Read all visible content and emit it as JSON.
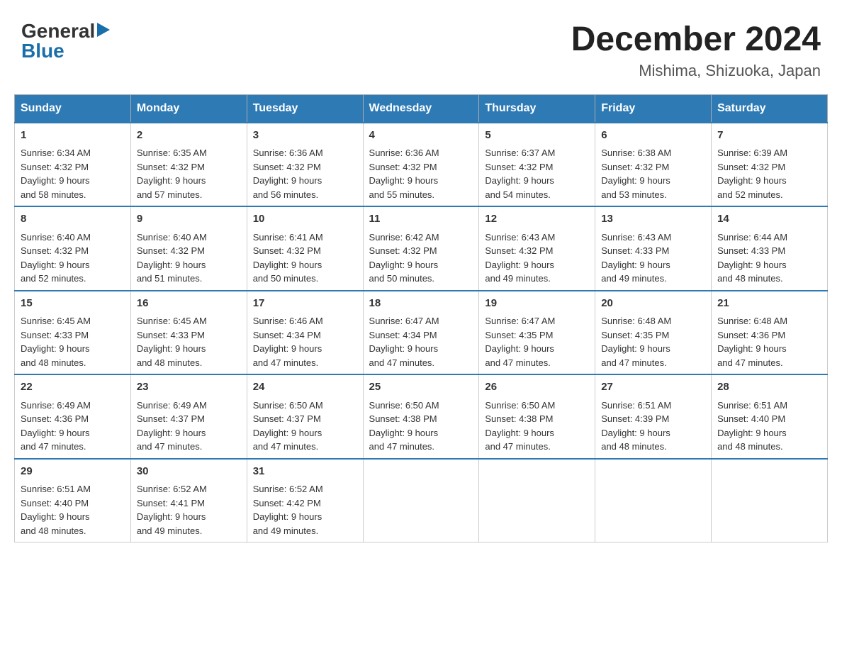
{
  "header": {
    "logo_general": "General",
    "logo_blue": "Blue",
    "title": "December 2024",
    "subtitle": "Mishima, Shizuoka, Japan"
  },
  "days_of_week": [
    "Sunday",
    "Monday",
    "Tuesday",
    "Wednesday",
    "Thursday",
    "Friday",
    "Saturday"
  ],
  "weeks": [
    [
      {
        "day": 1,
        "sunrise": "6:34 AM",
        "sunset": "4:32 PM",
        "daylight": "9 hours and 58 minutes."
      },
      {
        "day": 2,
        "sunrise": "6:35 AM",
        "sunset": "4:32 PM",
        "daylight": "9 hours and 57 minutes."
      },
      {
        "day": 3,
        "sunrise": "6:36 AM",
        "sunset": "4:32 PM",
        "daylight": "9 hours and 56 minutes."
      },
      {
        "day": 4,
        "sunrise": "6:36 AM",
        "sunset": "4:32 PM",
        "daylight": "9 hours and 55 minutes."
      },
      {
        "day": 5,
        "sunrise": "6:37 AM",
        "sunset": "4:32 PM",
        "daylight": "9 hours and 54 minutes."
      },
      {
        "day": 6,
        "sunrise": "6:38 AM",
        "sunset": "4:32 PM",
        "daylight": "9 hours and 53 minutes."
      },
      {
        "day": 7,
        "sunrise": "6:39 AM",
        "sunset": "4:32 PM",
        "daylight": "9 hours and 52 minutes."
      }
    ],
    [
      {
        "day": 8,
        "sunrise": "6:40 AM",
        "sunset": "4:32 PM",
        "daylight": "9 hours and 52 minutes."
      },
      {
        "day": 9,
        "sunrise": "6:40 AM",
        "sunset": "4:32 PM",
        "daylight": "9 hours and 51 minutes."
      },
      {
        "day": 10,
        "sunrise": "6:41 AM",
        "sunset": "4:32 PM",
        "daylight": "9 hours and 50 minutes."
      },
      {
        "day": 11,
        "sunrise": "6:42 AM",
        "sunset": "4:32 PM",
        "daylight": "9 hours and 50 minutes."
      },
      {
        "day": 12,
        "sunrise": "6:43 AM",
        "sunset": "4:32 PM",
        "daylight": "9 hours and 49 minutes."
      },
      {
        "day": 13,
        "sunrise": "6:43 AM",
        "sunset": "4:33 PM",
        "daylight": "9 hours and 49 minutes."
      },
      {
        "day": 14,
        "sunrise": "6:44 AM",
        "sunset": "4:33 PM",
        "daylight": "9 hours and 48 minutes."
      }
    ],
    [
      {
        "day": 15,
        "sunrise": "6:45 AM",
        "sunset": "4:33 PM",
        "daylight": "9 hours and 48 minutes."
      },
      {
        "day": 16,
        "sunrise": "6:45 AM",
        "sunset": "4:33 PM",
        "daylight": "9 hours and 48 minutes."
      },
      {
        "day": 17,
        "sunrise": "6:46 AM",
        "sunset": "4:34 PM",
        "daylight": "9 hours and 47 minutes."
      },
      {
        "day": 18,
        "sunrise": "6:47 AM",
        "sunset": "4:34 PM",
        "daylight": "9 hours and 47 minutes."
      },
      {
        "day": 19,
        "sunrise": "6:47 AM",
        "sunset": "4:35 PM",
        "daylight": "9 hours and 47 minutes."
      },
      {
        "day": 20,
        "sunrise": "6:48 AM",
        "sunset": "4:35 PM",
        "daylight": "9 hours and 47 minutes."
      },
      {
        "day": 21,
        "sunrise": "6:48 AM",
        "sunset": "4:36 PM",
        "daylight": "9 hours and 47 minutes."
      }
    ],
    [
      {
        "day": 22,
        "sunrise": "6:49 AM",
        "sunset": "4:36 PM",
        "daylight": "9 hours and 47 minutes."
      },
      {
        "day": 23,
        "sunrise": "6:49 AM",
        "sunset": "4:37 PM",
        "daylight": "9 hours and 47 minutes."
      },
      {
        "day": 24,
        "sunrise": "6:50 AM",
        "sunset": "4:37 PM",
        "daylight": "9 hours and 47 minutes."
      },
      {
        "day": 25,
        "sunrise": "6:50 AM",
        "sunset": "4:38 PM",
        "daylight": "9 hours and 47 minutes."
      },
      {
        "day": 26,
        "sunrise": "6:50 AM",
        "sunset": "4:38 PM",
        "daylight": "9 hours and 47 minutes."
      },
      {
        "day": 27,
        "sunrise": "6:51 AM",
        "sunset": "4:39 PM",
        "daylight": "9 hours and 48 minutes."
      },
      {
        "day": 28,
        "sunrise": "6:51 AM",
        "sunset": "4:40 PM",
        "daylight": "9 hours and 48 minutes."
      }
    ],
    [
      {
        "day": 29,
        "sunrise": "6:51 AM",
        "sunset": "4:40 PM",
        "daylight": "9 hours and 48 minutes."
      },
      {
        "day": 30,
        "sunrise": "6:52 AM",
        "sunset": "4:41 PM",
        "daylight": "9 hours and 49 minutes."
      },
      {
        "day": 31,
        "sunrise": "6:52 AM",
        "sunset": "4:42 PM",
        "daylight": "9 hours and 49 minutes."
      },
      null,
      null,
      null,
      null
    ]
  ],
  "labels": {
    "sunrise": "Sunrise:",
    "sunset": "Sunset:",
    "daylight": "Daylight:"
  }
}
